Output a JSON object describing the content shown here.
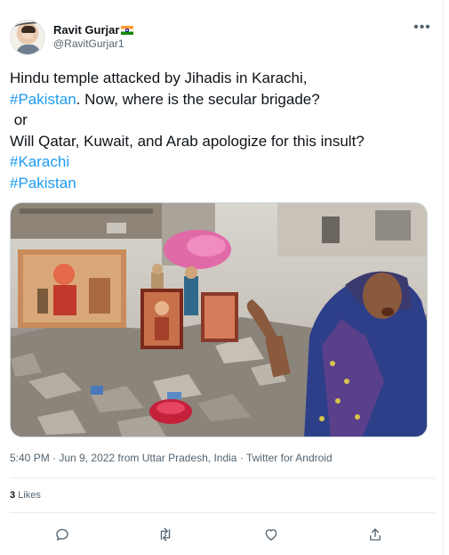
{
  "user": {
    "name": "Ravit Gurjar",
    "handle": "@RavitGurjar1"
  },
  "tweet": {
    "line1": "Hindu temple attacked by Jihadis in Karachi,",
    "line2_tag": "#Pakistan",
    "line2_rest": ". Now, where is the secular brigade?",
    "line3": " or",
    "line4": "Will Qatar, Kuwait, and Arab apologize for this insult?",
    "line5_tag": "#Karachi",
    "line6_tag": "#Pakistan"
  },
  "meta": {
    "time": "5:40 PM",
    "sep1": " · ",
    "date": "Jun 9, 2022 from Uttar Pradesh, India",
    "sep2": " · ",
    "client": "Twitter for Android"
  },
  "stats": {
    "likes_count": "3",
    "likes_label": "Likes"
  },
  "icons": {
    "more": "more-horizontal-icon",
    "reply": "reply-icon",
    "retweet": "retweet-icon",
    "like": "heart-icon",
    "share": "share-icon"
  },
  "colors": {
    "link": "#1d9bf0",
    "text": "#0f1419",
    "secondary": "#536471",
    "border": "#e6ecf0"
  }
}
